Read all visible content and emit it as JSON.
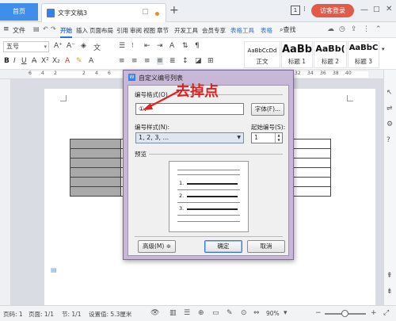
{
  "tabbar": {
    "home": "首页",
    "doc_title": "文字文稿3",
    "add": "+",
    "visitor": "访客登录",
    "win_badge": "1"
  },
  "menubar": {
    "file": "文件",
    "items": [
      "开始",
      "插入",
      "页面布局",
      "引用",
      "审阅",
      "视图",
      "章节",
      "开发工具",
      "会员专享",
      "表格工具",
      "表格"
    ],
    "active": "开始",
    "search": "查找"
  },
  "ribbon": {
    "font_size": "五号",
    "styles": [
      {
        "sample": "AaBbCcDd",
        "name": "正文"
      },
      {
        "sample": "AaBb",
        "name": "标题 1"
      },
      {
        "sample": "AaBb(",
        "name": "标题 2"
      },
      {
        "sample": "AaBbC",
        "name": "标题 3"
      }
    ]
  },
  "ruler": {
    "numbers": [
      "6",
      "4",
      "2",
      "2",
      "4",
      "6",
      "8",
      "10",
      "12",
      "14",
      "16",
      "18",
      "20",
      "22",
      "24",
      "26",
      "28",
      "30",
      "32",
      "34",
      "36",
      "38",
      "40"
    ]
  },
  "dialog": {
    "title": "自定义编号列表",
    "format_label": "编号格式(O)",
    "format_value": "①.",
    "font_button": "字体(F)...",
    "style_label": "编号样式(N):",
    "style_value": "1, 2, 3, ...",
    "start_label": "起始编号(S):",
    "start_value": "1",
    "preview_label": "预览",
    "preview_items": [
      "1.",
      "2.",
      "3."
    ],
    "advanced_button": "高级(M) ≑",
    "ok_button": "确定",
    "cancel_button": "取消"
  },
  "annotation": {
    "text": "去掉点",
    "color": "#e02020"
  },
  "statusbar": {
    "page": "页码: 1",
    "pages": "页面: 1/1",
    "section": "节: 1/1",
    "setting": "设置值: 5.3厘米",
    "zoom": "90%"
  }
}
